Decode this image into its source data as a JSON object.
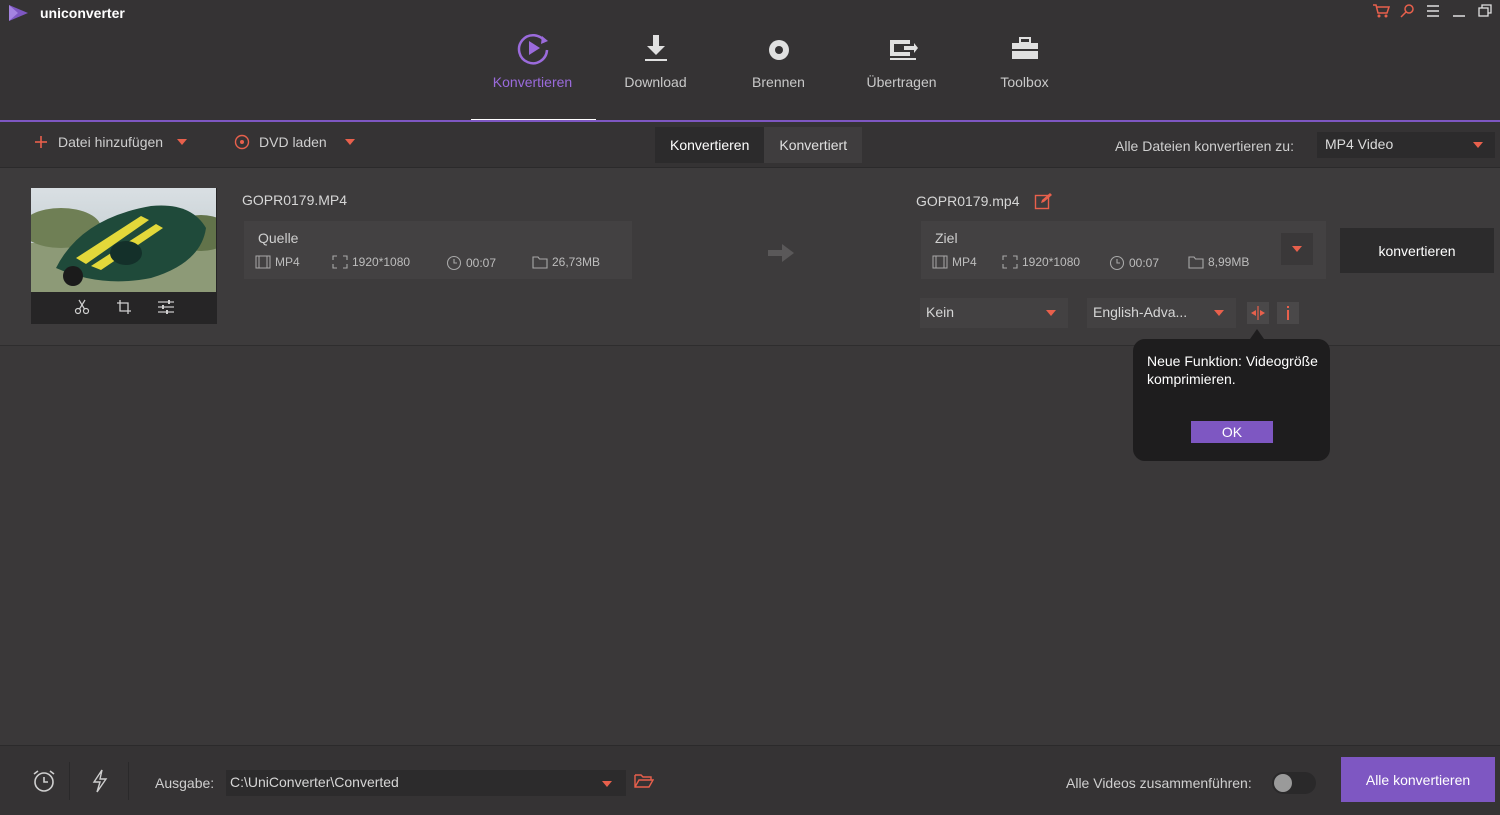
{
  "app": {
    "name": "uniconverter"
  },
  "nav": {
    "tabs": [
      {
        "label": "Konvertieren",
        "icon": "convert-icon",
        "active": true
      },
      {
        "label": "Download",
        "icon": "download-icon",
        "active": false
      },
      {
        "label": "Brennen",
        "icon": "burn-icon",
        "active": false
      },
      {
        "label": "Übertragen",
        "icon": "transfer-icon",
        "active": false
      },
      {
        "label": "Toolbox",
        "icon": "toolbox-icon",
        "active": false
      }
    ]
  },
  "toolbar": {
    "add_file": "Datei hinzufügen",
    "load_dvd": "DVD laden",
    "seg_converting": "Konvertieren",
    "seg_converted": "Konvertiert",
    "convert_all_to_label": "Alle Dateien konvertieren zu:",
    "format_value": "MP4 Video"
  },
  "file": {
    "source_name": "GOPR0179.MP4",
    "source": {
      "title": "Quelle",
      "format": "MP4",
      "resolution": "1920*1080",
      "duration": "00:07",
      "size": "26,73MB"
    },
    "target_name": "GOPR0179.mp4",
    "target": {
      "title": "Ziel",
      "format": "MP4",
      "resolution": "1920*1080",
      "duration": "00:07",
      "size": "8,99MB"
    },
    "convert_button": "konvertieren",
    "subtitle_value": "Kein",
    "audio_value": "English-Adva..."
  },
  "tooltip": {
    "text": "Neue Funktion: Videogröße komprimieren.",
    "ok": "OK"
  },
  "bottom": {
    "output_label": "Ausgabe:",
    "output_path": "C:\\UniConverter\\Converted",
    "merge_label": "Alle Videos zusammenführen:",
    "merge_on": false,
    "convert_all": "Alle konvertieren"
  },
  "colors": {
    "accent": "#7e57c2",
    "accent_text": "#9b6bdc",
    "orange": "#e8604c"
  }
}
